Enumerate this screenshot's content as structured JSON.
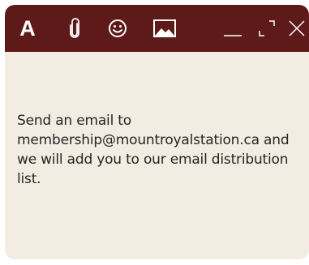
{
  "toolbar": {
    "format_label": "A",
    "icons": {
      "format": "text-format-icon",
      "attach": "paperclip-icon",
      "emoji": "smiley-icon",
      "image": "image-icon",
      "minimize": "minimize-icon",
      "expand": "expand-icon",
      "close": "close-icon"
    }
  },
  "message": {
    "text": "Send an email to membership@mountroyalstation.ca and we will add you to our email distribution list."
  },
  "colors": {
    "toolbar_background": "#5e1919",
    "card_background": "#f2ece2",
    "icon_color": "#ffffff",
    "text_color": "#2a2422"
  }
}
